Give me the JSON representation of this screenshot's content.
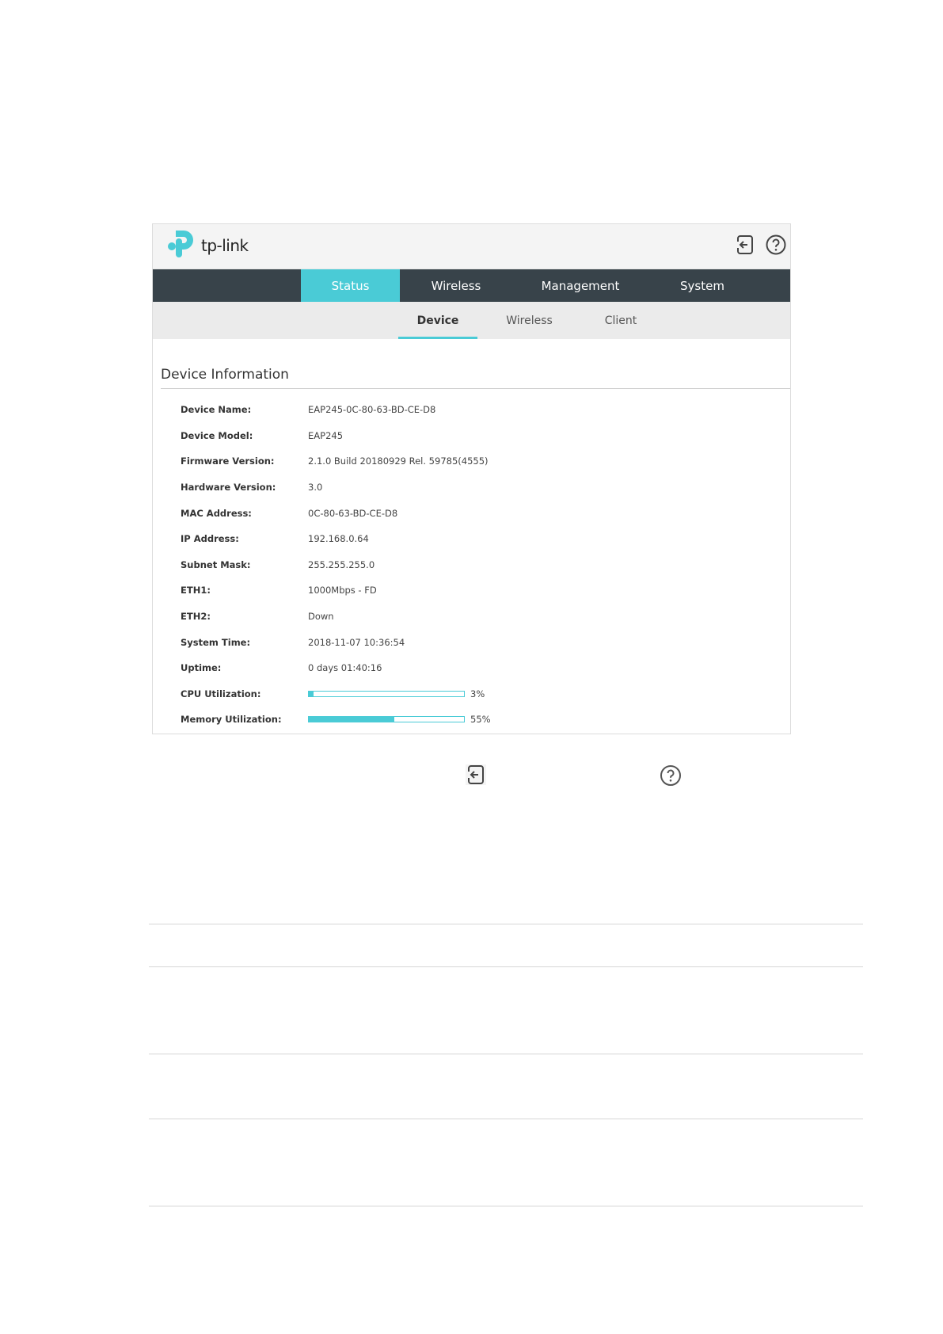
{
  "brand": {
    "name": "tp-link",
    "accent": "#4acbd6",
    "nav_bg": "#38434a"
  },
  "header": {
    "icons": [
      "logout-icon",
      "help-icon"
    ]
  },
  "main_nav": {
    "tabs": [
      {
        "label": "Status",
        "active": true
      },
      {
        "label": "Wireless",
        "active": false
      },
      {
        "label": "Management",
        "active": false
      },
      {
        "label": "System",
        "active": false
      }
    ]
  },
  "sub_nav": {
    "tabs": [
      {
        "label": "Device",
        "active": true
      },
      {
        "label": "Wireless",
        "active": false
      },
      {
        "label": "Client",
        "active": false
      }
    ]
  },
  "device_info": {
    "title": "Device Information",
    "rows": [
      {
        "label": "Device Name:",
        "value": "EAP245-0C-80-63-BD-CE-D8"
      },
      {
        "label": "Device Model:",
        "value": "EAP245"
      },
      {
        "label": "Firmware Version:",
        "value": "2.1.0 Build 20180929 Rel. 59785(4555)"
      },
      {
        "label": "Hardware Version:",
        "value": "3.0"
      },
      {
        "label": "MAC Address:",
        "value": "0C-80-63-BD-CE-D8"
      },
      {
        "label": "IP Address:",
        "value": "192.168.0.64"
      },
      {
        "label": "Subnet Mask:",
        "value": "255.255.255.0"
      },
      {
        "label": "ETH1:",
        "value": "1000Mbps - FD"
      },
      {
        "label": "ETH2:",
        "value": "Down"
      },
      {
        "label": "System Time:",
        "value": "2018-11-07 10:36:54"
      },
      {
        "label": "Uptime:",
        "value": "0 days 01:40:16"
      }
    ],
    "cpu": {
      "label": "CPU Utilization:",
      "value_text": "3%",
      "percent": 3
    },
    "memory": {
      "label": "Memory Utilization:",
      "value_text": "55%",
      "percent": 55
    }
  }
}
